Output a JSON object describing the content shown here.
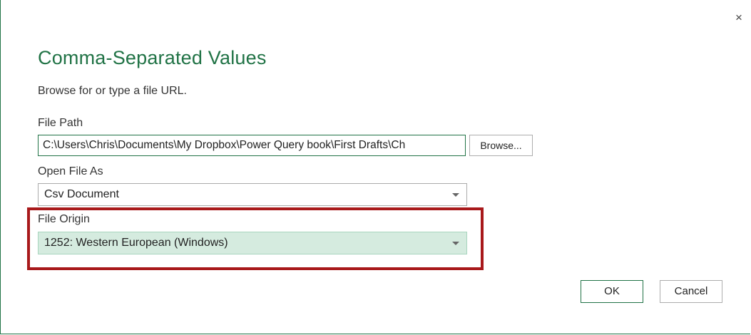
{
  "dialog": {
    "title": "Comma-Separated Values",
    "subtitle": "Browse for or type a file URL.",
    "close_glyph": "×"
  },
  "file_path": {
    "label": "File Path",
    "value": "C:\\Users\\Chris\\Documents\\My Dropbox\\Power Query book\\First Drafts\\Ch",
    "browse_label": "Browse..."
  },
  "open_file_as": {
    "label": "Open File As",
    "selected": "Csv Document"
  },
  "file_origin": {
    "label": "File Origin",
    "selected": "1252: Western European (Windows)"
  },
  "footer": {
    "ok_label": "OK",
    "cancel_label": "Cancel"
  },
  "colors": {
    "accent": "#217346",
    "highlight": "#a8191b",
    "selected_fill": "#d5ebdf"
  },
  "icons": {
    "close": "close-icon",
    "dropdown": "chevron-down-icon"
  }
}
